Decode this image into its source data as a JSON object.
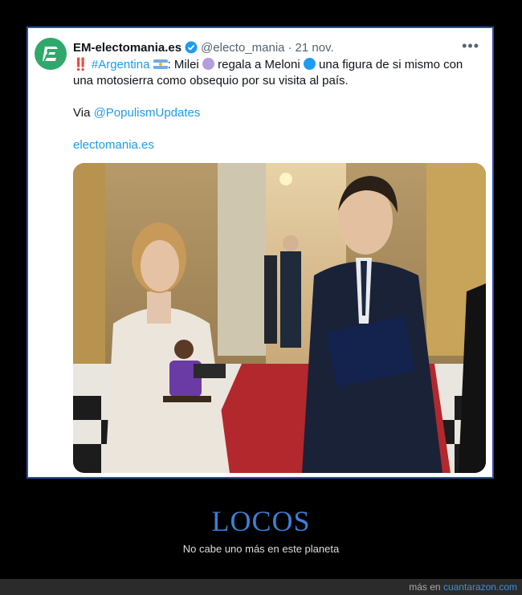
{
  "tweet": {
    "name": "EM-electomania.es",
    "handle": "@electo_mania",
    "separator": "·",
    "date": "21 nov.",
    "more": "•••",
    "line1_bang": "‼️",
    "hashtag": "#Argentina",
    "after_flag": ": Milei",
    "mid": "regala a Meloni",
    "after_circle": "una figura de si mismo con",
    "line2": "una motosierra como obsequio por su visita al país.",
    "via_label": "Via ",
    "via_link": "@PopulismUpdates",
    "site_link": "electomania.es",
    "colors": {
      "milei_circle": "#b39ddb",
      "meloni_circle": "#1d9bf0"
    }
  },
  "caption": {
    "title": "LOCOS",
    "subtitle": "No cabe uno más en este planeta"
  },
  "footer": {
    "prefix": "más en ",
    "site": "cuantarazon.com"
  }
}
